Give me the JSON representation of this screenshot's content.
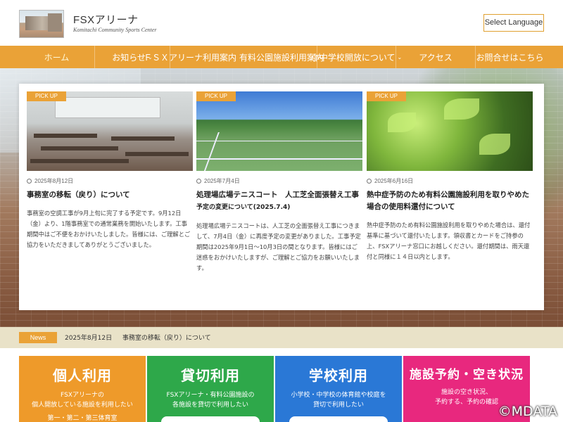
{
  "site": {
    "title": "FSXアリーナ",
    "subtitle": "Komitachi Community Sports Center",
    "language_button": "Select Language"
  },
  "nav": {
    "items": [
      {
        "label": "ホーム",
        "dropdown": false
      },
      {
        "label": "お知らせ",
        "dropdown": true
      },
      {
        "label": "ＦＳＸアリーナ利用案内",
        "dropdown": false
      },
      {
        "label": "有料公園施設利用案内",
        "dropdown": false
      },
      {
        "label": "小中学校開放について",
        "dropdown": true
      },
      {
        "label": "アクセス",
        "dropdown": false
      },
      {
        "label": "お問合せはこちら",
        "dropdown": false
      }
    ]
  },
  "pickup": {
    "badge": "PICK UP",
    "cards": [
      {
        "date": "2025年8月12日",
        "title": "事務室の移転（戻り）について",
        "subtitle": "",
        "body": "事務室の空調工事が9月上旬に完了する予定です。9月12日（金）より、1階事務室での通常業務を開始いたします。工事期間中はご不便をおかけいたしました。皆様には、ご理解とご協力をいただきましてありがとうございました。"
      },
      {
        "date": "2025年7月4日",
        "title": "処理場広場テニスコート　人工芝全面張替え工事",
        "subtitle": "予定の変更について(2025.7.4)",
        "body": "処理場広場テニスコートは、人工芝の全面張替え工事につきまして、7月4日（金）に再度予定の変更がありました。工事予定期間は2025年9月1日～10月3日の間となります。皆様にはご迷惑をおかけいたしますが、ご理解とご協力をお願いいたします。"
      },
      {
        "date": "2025年6月16日",
        "title": "熱中症予防のため有料公園施設利用を取りやめた場合の使用料還付について",
        "subtitle": "",
        "body": "熱中症予防のため有料公園施設利用を取りやめた場合は、還付基準に基づいて還付いたします。領収書とカードをご持参の上、FSXアリーナ窓口にお越しください。還付期間は、雨天還付と同様に１４日以内とします。"
      }
    ]
  },
  "news": {
    "tag": "News",
    "date": "2025年8月12日",
    "text": "事務室の移転（戻り）について"
  },
  "tiles": [
    {
      "title": "個人利用",
      "line1": "FSXアリーナの",
      "line2": "個人開放している施設を利用したい",
      "extra": "第一・第二・第三体育室",
      "color": "#ee9a2a"
    },
    {
      "title": "貸切利用",
      "line1": "FSXアリーナ・有料公園施設の",
      "line2": "各施設を貸切で利用したい",
      "extra": "",
      "color": "#2ea84a"
    },
    {
      "title": "学校利用",
      "line1": "小学校・中学校の体育館や校庭を",
      "line2": "貸切で利用したい",
      "extra": "",
      "color": "#2a78d6"
    },
    {
      "title": "施設予約・空き状況",
      "line1": "施設の空き状況、",
      "line2": "予約する、予約の確認",
      "extra": "",
      "color": "#e8287e"
    }
  ],
  "watermark": "©MDATA",
  "colors": {
    "accent": "#eaa237",
    "news_bg": "#e9e2c8"
  }
}
